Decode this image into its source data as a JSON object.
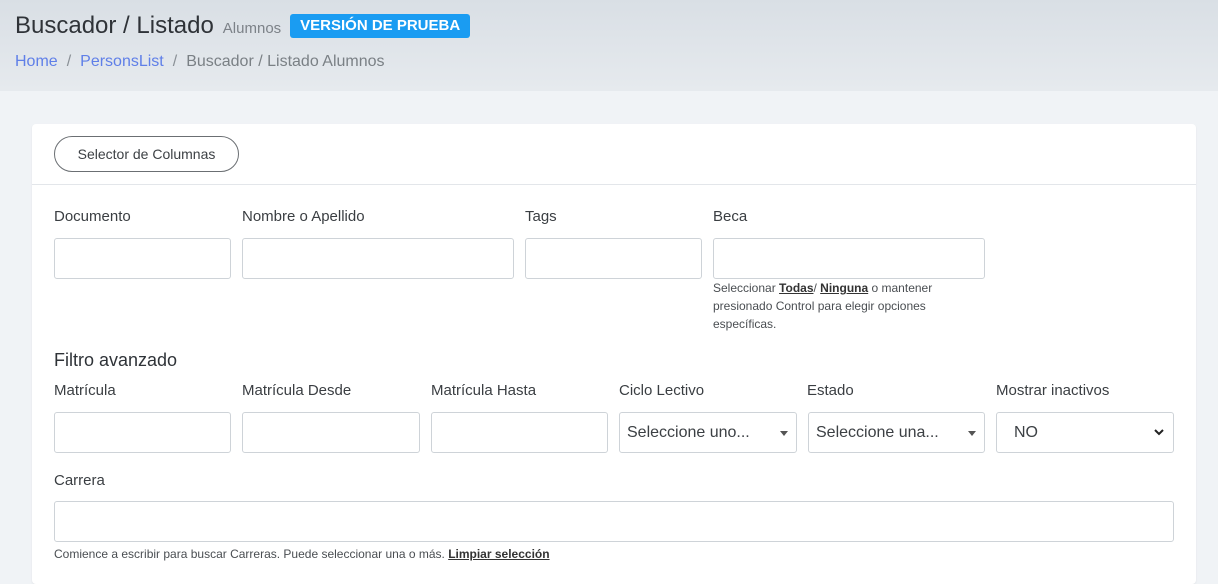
{
  "header": {
    "title": "Buscador / Listado",
    "subtitle": "Alumnos",
    "badge": "VERSIÓN DE PRUEBA",
    "breadcrumb": [
      "Home",
      "PersonsList",
      "Buscador / Listado Alumnos"
    ]
  },
  "toolbar": {
    "column_selector_label": "Selector de Columnas"
  },
  "filters": {
    "documento": {
      "label": "Documento",
      "value": ""
    },
    "nombre": {
      "label": "Nombre o Apellido",
      "value": ""
    },
    "tags": {
      "label": "Tags",
      "value": ""
    },
    "beca": {
      "label": "Beca",
      "help_prefix": "Seleccionar ",
      "help_all": "Todas",
      "help_sep": "/ ",
      "help_none": "Ninguna",
      "help_suffix": " o mantener presionado Control para elegir opciones específicas."
    }
  },
  "advanced": {
    "title": "Filtro avanzado",
    "matricula": {
      "label": "Matrícula",
      "value": ""
    },
    "matricula_desde": {
      "label": "Matrícula Desde",
      "value": ""
    },
    "matricula_hasta": {
      "label": "Matrícula Hasta",
      "value": ""
    },
    "ciclo_lectivo": {
      "label": "Ciclo Lectivo",
      "selected": "Seleccione uno..."
    },
    "estado": {
      "label": "Estado",
      "selected": "Seleccione una..."
    },
    "mostrar_inactivos": {
      "label": "Mostrar inactivos",
      "selected": "NO"
    },
    "carrera": {
      "label": "Carrera",
      "value": "",
      "help": "Comience a escribir para buscar Carreras. Puede seleccionar una o más. ",
      "clear_link": "Limpiar selección"
    }
  },
  "colors": {
    "accent": "#1a9cf2",
    "link": "#5f7fe8"
  }
}
